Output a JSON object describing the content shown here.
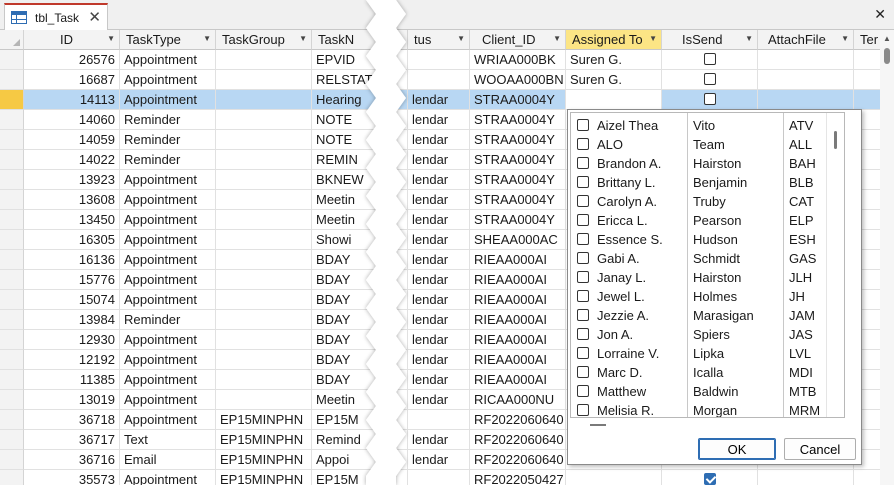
{
  "tab": {
    "title": "tbl_Task"
  },
  "columns": [
    "ID",
    "TaskType",
    "TaskGroup",
    "TaskN",
    "tus",
    "Client_ID",
    "Assigned To",
    "IsSend",
    "AttachFile",
    "Ter"
  ],
  "rows": [
    {
      "id": "26576",
      "type": "Appointment",
      "group": "",
      "name": "EPVID",
      "status": "",
      "client": "WRIAA000BK",
      "assigned": "Suren G.",
      "issend": false,
      "attach": ""
    },
    {
      "id": "16687",
      "type": "Appointment",
      "group": "",
      "name": "RELSTAT",
      "status": "",
      "client": "WOOAA000BN",
      "assigned": "Suren G.",
      "issend": false,
      "attach": ""
    },
    {
      "id": "14113",
      "type": "Appointment",
      "group": "",
      "name": "Hearing",
      "status": "lendar",
      "client": "STRAA0004Y",
      "assigned": "",
      "issend": false,
      "attach": ""
    },
    {
      "id": "14060",
      "type": "Reminder",
      "group": "",
      "name": "NOTE",
      "status": "lendar",
      "client": "STRAA0004Y",
      "assigned": "",
      "issend": false,
      "attach": ""
    },
    {
      "id": "14059",
      "type": "Reminder",
      "group": "",
      "name": "NOTE",
      "status": "lendar",
      "client": "STRAA0004Y",
      "assigned": "",
      "issend": false,
      "attach": ""
    },
    {
      "id": "14022",
      "type": "Reminder",
      "group": "",
      "name": "REMIN",
      "status": "lendar",
      "client": "STRAA0004Y",
      "assigned": "",
      "issend": false,
      "attach": ""
    },
    {
      "id": "13923",
      "type": "Appointment",
      "group": "",
      "name": "BKNEW",
      "status": "lendar",
      "client": "STRAA0004Y",
      "assigned": "",
      "issend": false,
      "attach": ""
    },
    {
      "id": "13608",
      "type": "Appointment",
      "group": "",
      "name": "Meetin",
      "status": "lendar",
      "client": "STRAA0004Y",
      "assigned": "",
      "issend": false,
      "attach": ""
    },
    {
      "id": "13450",
      "type": "Appointment",
      "group": "",
      "name": "Meetin",
      "status": "lendar",
      "client": "STRAA0004Y",
      "assigned": "",
      "issend": false,
      "attach": ""
    },
    {
      "id": "16305",
      "type": "Appointment",
      "group": "",
      "name": "Showi",
      "status": "lendar",
      "client": "SHEAA000AC",
      "assigned": "",
      "issend": false,
      "attach": ""
    },
    {
      "id": "16136",
      "type": "Appointment",
      "group": "",
      "name": "BDAY",
      "status": "lendar",
      "client": "RIEAA000AI",
      "assigned": "",
      "issend": false,
      "attach": ""
    },
    {
      "id": "15776",
      "type": "Appointment",
      "group": "",
      "name": "BDAY",
      "status": "lendar",
      "client": "RIEAA000AI",
      "assigned": "",
      "issend": false,
      "attach": ""
    },
    {
      "id": "15074",
      "type": "Appointment",
      "group": "",
      "name": "BDAY",
      "status": "lendar",
      "client": "RIEAA000AI",
      "assigned": "",
      "issend": false,
      "attach": ""
    },
    {
      "id": "13984",
      "type": "Reminder",
      "group": "",
      "name": "BDAY",
      "status": "lendar",
      "client": "RIEAA000AI",
      "assigned": "",
      "issend": false,
      "attach": ""
    },
    {
      "id": "12930",
      "type": "Appointment",
      "group": "",
      "name": "BDAY",
      "status": "lendar",
      "client": "RIEAA000AI",
      "assigned": "",
      "issend": false,
      "attach": ""
    },
    {
      "id": "12192",
      "type": "Appointment",
      "group": "",
      "name": "BDAY",
      "status": "lendar",
      "client": "RIEAA000AI",
      "assigned": "",
      "issend": false,
      "attach": ""
    },
    {
      "id": "11385",
      "type": "Appointment",
      "group": "",
      "name": "BDAY",
      "status": "lendar",
      "client": "RIEAA000AI",
      "assigned": "",
      "issend": false,
      "attach": ""
    },
    {
      "id": "13019",
      "type": "Appointment",
      "group": "",
      "name": "Meetin",
      "status": "lendar",
      "client": "RICAA000NU",
      "assigned": "",
      "issend": false,
      "attach": ""
    },
    {
      "id": "36718",
      "type": "Appointment",
      "group": "EP15MINPHN",
      "name": "EP15M",
      "status": "",
      "client": "RF2022060640",
      "assigned": "",
      "issend": false,
      "attach": ""
    },
    {
      "id": "36717",
      "type": "Text",
      "group": "EP15MINPHN",
      "name": "Remind",
      "status": "lendar",
      "client": "RF2022060640",
      "assigned": "",
      "issend": false,
      "attach": ""
    },
    {
      "id": "36716",
      "type": "Email",
      "group": "EP15MINPHN",
      "name": "Appoi",
      "status": "lendar",
      "client": "RF2022060640",
      "assigned": "",
      "issend": true,
      "attach": ""
    },
    {
      "id": "35573",
      "type": "Appointment",
      "group": "EP15MINPHN",
      "name": "EP15M",
      "status": "",
      "client": "RF2022050427",
      "assigned": "",
      "issend": true,
      "attach": ""
    }
  ],
  "dropdown": {
    "options": [
      {
        "first": "Aizel Thea",
        "last": "Vito",
        "code": "ATV"
      },
      {
        "first": "ALO",
        "last": "Team",
        "code": "ALL"
      },
      {
        "first": "Brandon A.",
        "last": "Hairston",
        "code": "BAH"
      },
      {
        "first": "Brittany L.",
        "last": "Benjamin",
        "code": "BLB"
      },
      {
        "first": "Carolyn A.",
        "last": "Truby",
        "code": "CAT"
      },
      {
        "first": "Ericca L.",
        "last": "Pearson",
        "code": "ELP"
      },
      {
        "first": "Essence S.",
        "last": "Hudson",
        "code": "ESH"
      },
      {
        "first": "Gabi A.",
        "last": "Schmidt",
        "code": "GAS"
      },
      {
        "first": "Janay L.",
        "last": "Hairston",
        "code": "JLH"
      },
      {
        "first": "Jewel L.",
        "last": "Holmes",
        "code": "JH"
      },
      {
        "first": "Jezzie A.",
        "last": "Marasigan",
        "code": "JAM"
      },
      {
        "first": "Jon A.",
        "last": "Spiers",
        "code": "JAS"
      },
      {
        "first": "Lorraine V.",
        "last": "Lipka",
        "code": "LVL"
      },
      {
        "first": "Marc D.",
        "last": "Icalla",
        "code": "MDI"
      },
      {
        "first": "Matthew",
        "last": "Baldwin",
        "code": "MTB"
      },
      {
        "first": "Melisia R.",
        "last": "Morgan",
        "code": "MRM"
      }
    ],
    "ok_label": "OK",
    "cancel_label": "Cancel"
  }
}
